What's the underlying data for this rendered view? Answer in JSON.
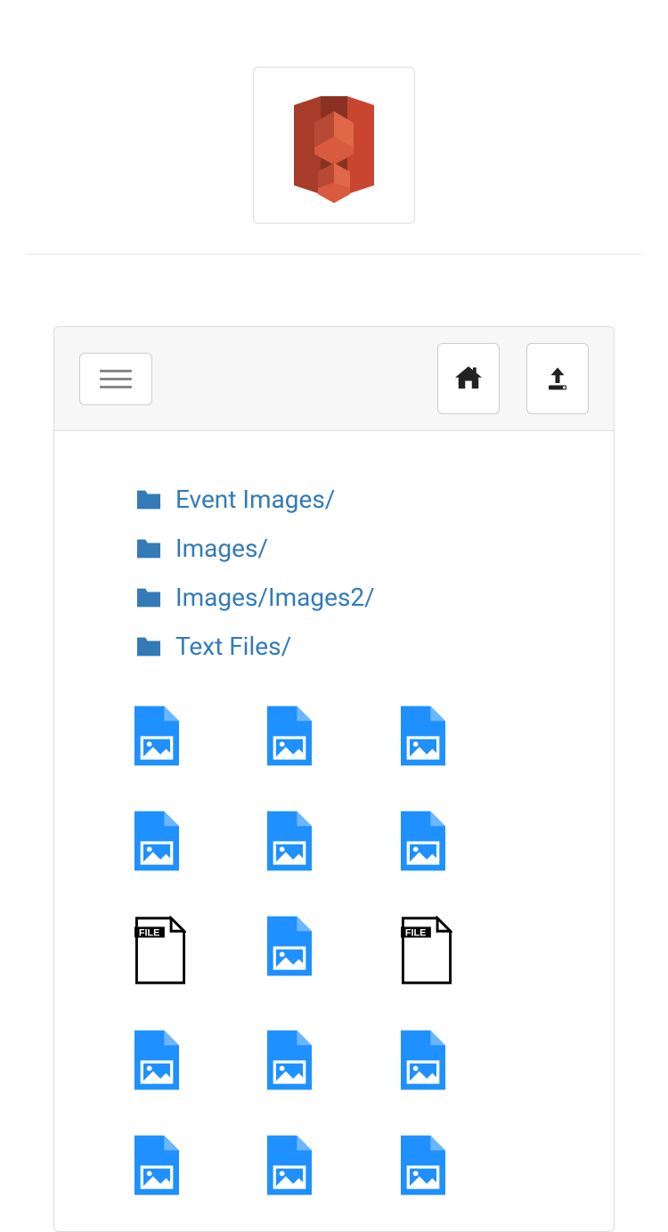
{
  "folders": [
    {
      "name": "Event Images/"
    },
    {
      "name": "Images/"
    },
    {
      "name": "Images/Images2/"
    },
    {
      "name": "Text Files/"
    }
  ],
  "files": [
    {
      "type": "image"
    },
    {
      "type": "image"
    },
    {
      "type": "image"
    },
    {
      "type": "image"
    },
    {
      "type": "image"
    },
    {
      "type": "image"
    },
    {
      "type": "generic"
    },
    {
      "type": "image"
    },
    {
      "type": "generic"
    },
    {
      "type": "image"
    },
    {
      "type": "image"
    },
    {
      "type": "image"
    },
    {
      "type": "image"
    },
    {
      "type": "image"
    },
    {
      "type": "image"
    }
  ]
}
